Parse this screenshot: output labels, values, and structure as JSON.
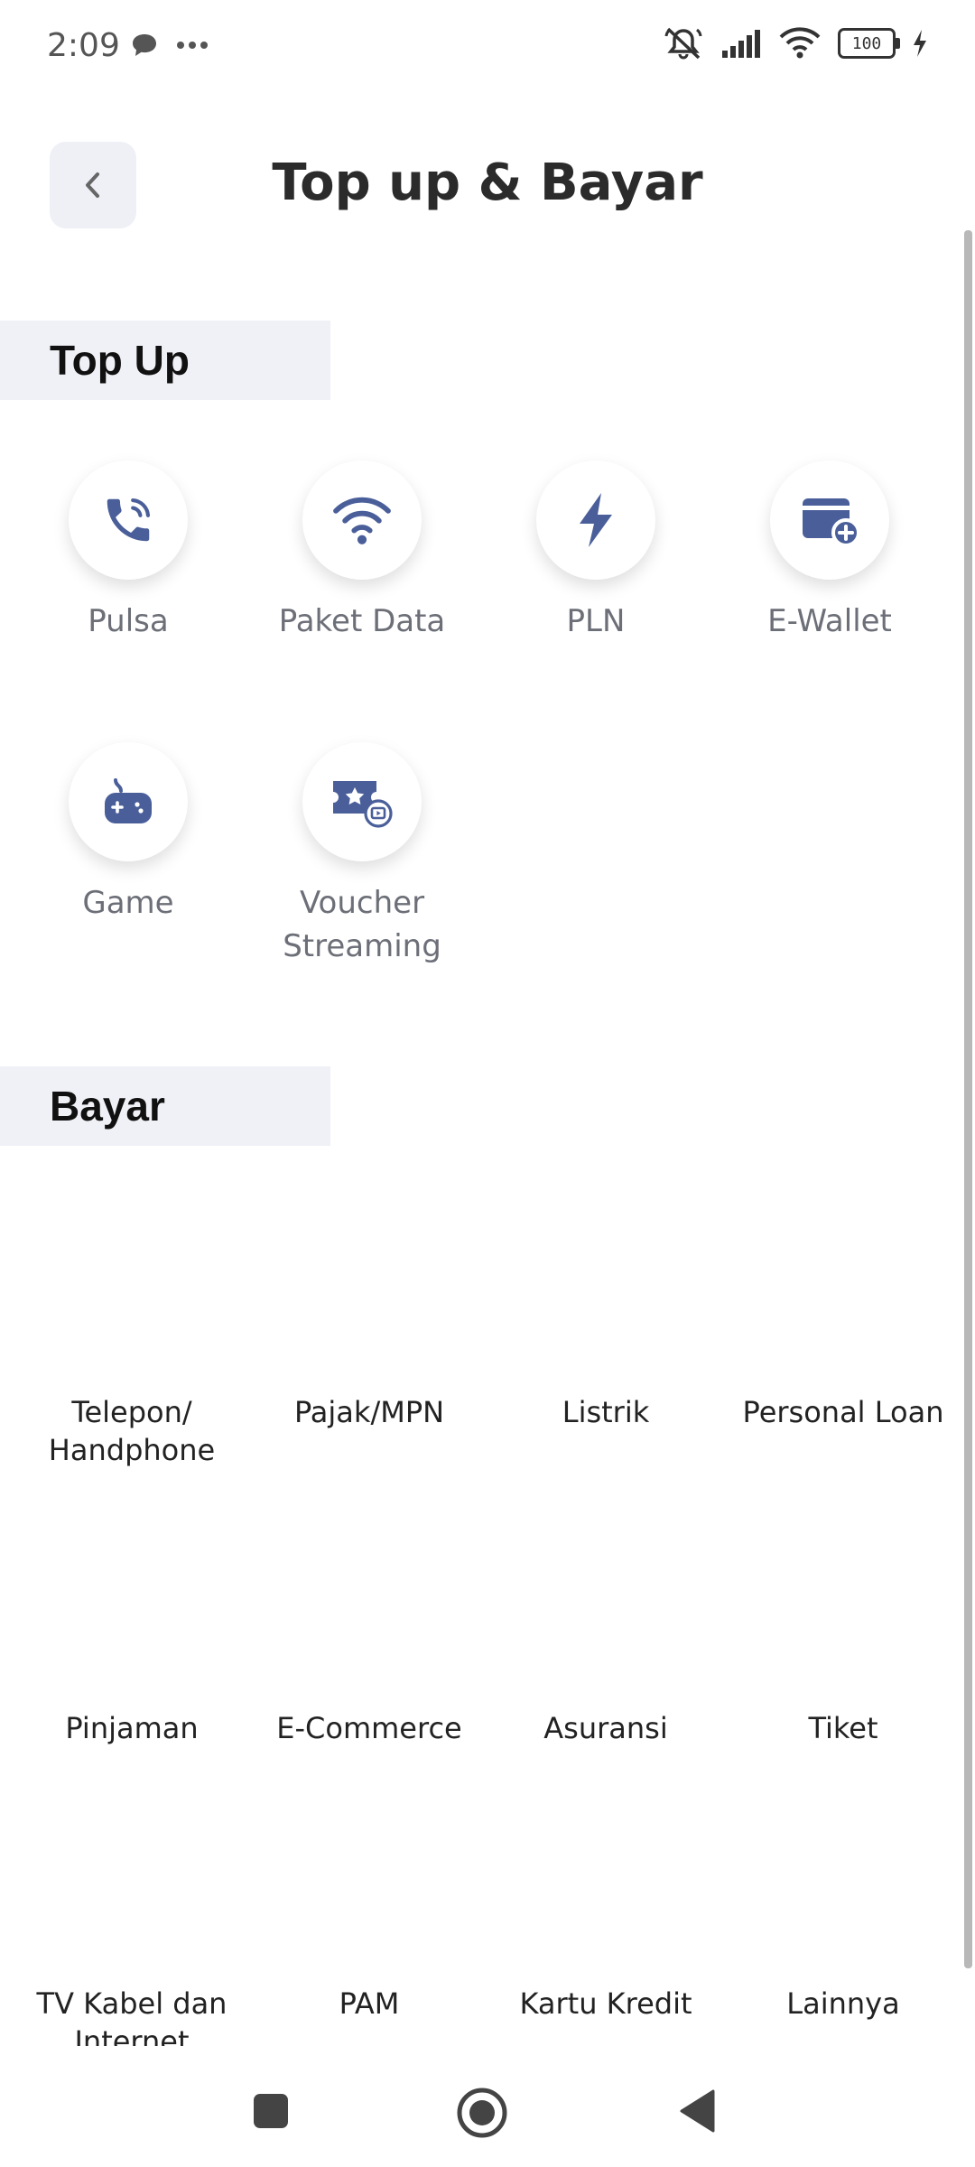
{
  "status_bar": {
    "time": "2:09",
    "battery": "100",
    "left_icons": [
      "chat-icon",
      "more-dots-icon"
    ],
    "right_icons": [
      "mute-icon",
      "signal-icon",
      "wifi-icon",
      "battery-icon",
      "charging-icon"
    ]
  },
  "header": {
    "title": "Top up & Bayar",
    "back_icon": "chevron-left-icon"
  },
  "topup": {
    "heading": "Top Up",
    "items": [
      {
        "label": "Pulsa",
        "icon": "phone-icon"
      },
      {
        "label": "Paket Data",
        "icon": "wifi-icon"
      },
      {
        "label": "PLN",
        "icon": "lightning-icon"
      },
      {
        "label": "E-Wallet",
        "icon": "wallet-icon"
      },
      {
        "label": "Game",
        "icon": "gamepad-icon"
      },
      {
        "label": "Voucher Streaming",
        "icon": "voucher-icon"
      }
    ]
  },
  "bayar": {
    "heading": "Bayar",
    "items": [
      {
        "label": "Telepon/ Handphone"
      },
      {
        "label": "Pajak/MPN"
      },
      {
        "label": "Listrik"
      },
      {
        "label": "Personal Loan"
      },
      {
        "label": "Pinjaman"
      },
      {
        "label": "E-Commerce"
      },
      {
        "label": "Asuransi"
      },
      {
        "label": "Tiket"
      },
      {
        "label": "TV Kabel dan Internet"
      },
      {
        "label": "PAM"
      },
      {
        "label": "Kartu Kredit"
      },
      {
        "label": "Lainnya"
      }
    ]
  },
  "colors": {
    "icon": "#4a5f9a",
    "section_bg": "#f0f1f6"
  }
}
